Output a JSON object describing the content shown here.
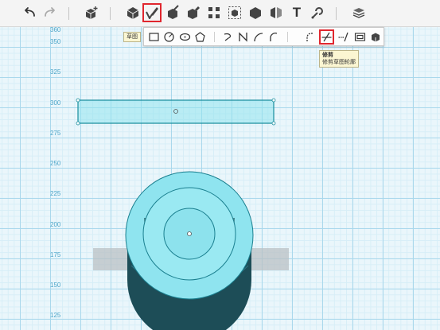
{
  "colors": {
    "accent_highlight": "#e0262e",
    "grid_major": "#aad8ec",
    "grid_minor": "#d7eef7",
    "axis_label": "#4fa6c9",
    "shape_fill": "#8fe4ef",
    "shape_stroke": "#1a8e9e"
  },
  "toolbar": {
    "items": [
      {
        "icon": "undo-icon"
      },
      {
        "icon": "redo-icon"
      },
      {
        "icon": "add-cube-icon"
      },
      {
        "icon": "primitives-icon"
      },
      {
        "icon": "sketch-icon",
        "selected": true
      },
      {
        "icon": "construct-icon"
      },
      {
        "icon": "modify-icon"
      },
      {
        "icon": "pattern-icon"
      },
      {
        "icon": "grouping-icon"
      },
      {
        "icon": "combine-icon"
      },
      {
        "icon": "measure-icon"
      },
      {
        "icon": "text-icon",
        "glyph": "T"
      },
      {
        "icon": "snap-icon"
      },
      {
        "icon": "material-icon"
      }
    ]
  },
  "sketch_tooltip": "草图",
  "sketch_palette": {
    "items": [
      {
        "icon": "rectangle-icon"
      },
      {
        "icon": "circle-icon"
      },
      {
        "icon": "ellipse-icon"
      },
      {
        "icon": "polygon-icon"
      },
      {
        "icon": "polyline-icon"
      },
      {
        "icon": "spline-icon"
      },
      {
        "icon": "arc-icon"
      },
      {
        "icon": "two-point-arc-icon"
      },
      {
        "icon": "fillet-icon"
      },
      {
        "icon": "trim-icon",
        "selected": true
      },
      {
        "icon": "extend-icon"
      },
      {
        "icon": "offset-icon"
      },
      {
        "icon": "project-icon"
      }
    ]
  },
  "trim_tooltip": {
    "title": "修剪",
    "description": "修剪草图轮廓"
  },
  "y_axis_labels": [
    "360",
    "350",
    "325",
    "300",
    "275",
    "250",
    "225",
    "200",
    "175",
    "150",
    "125"
  ]
}
